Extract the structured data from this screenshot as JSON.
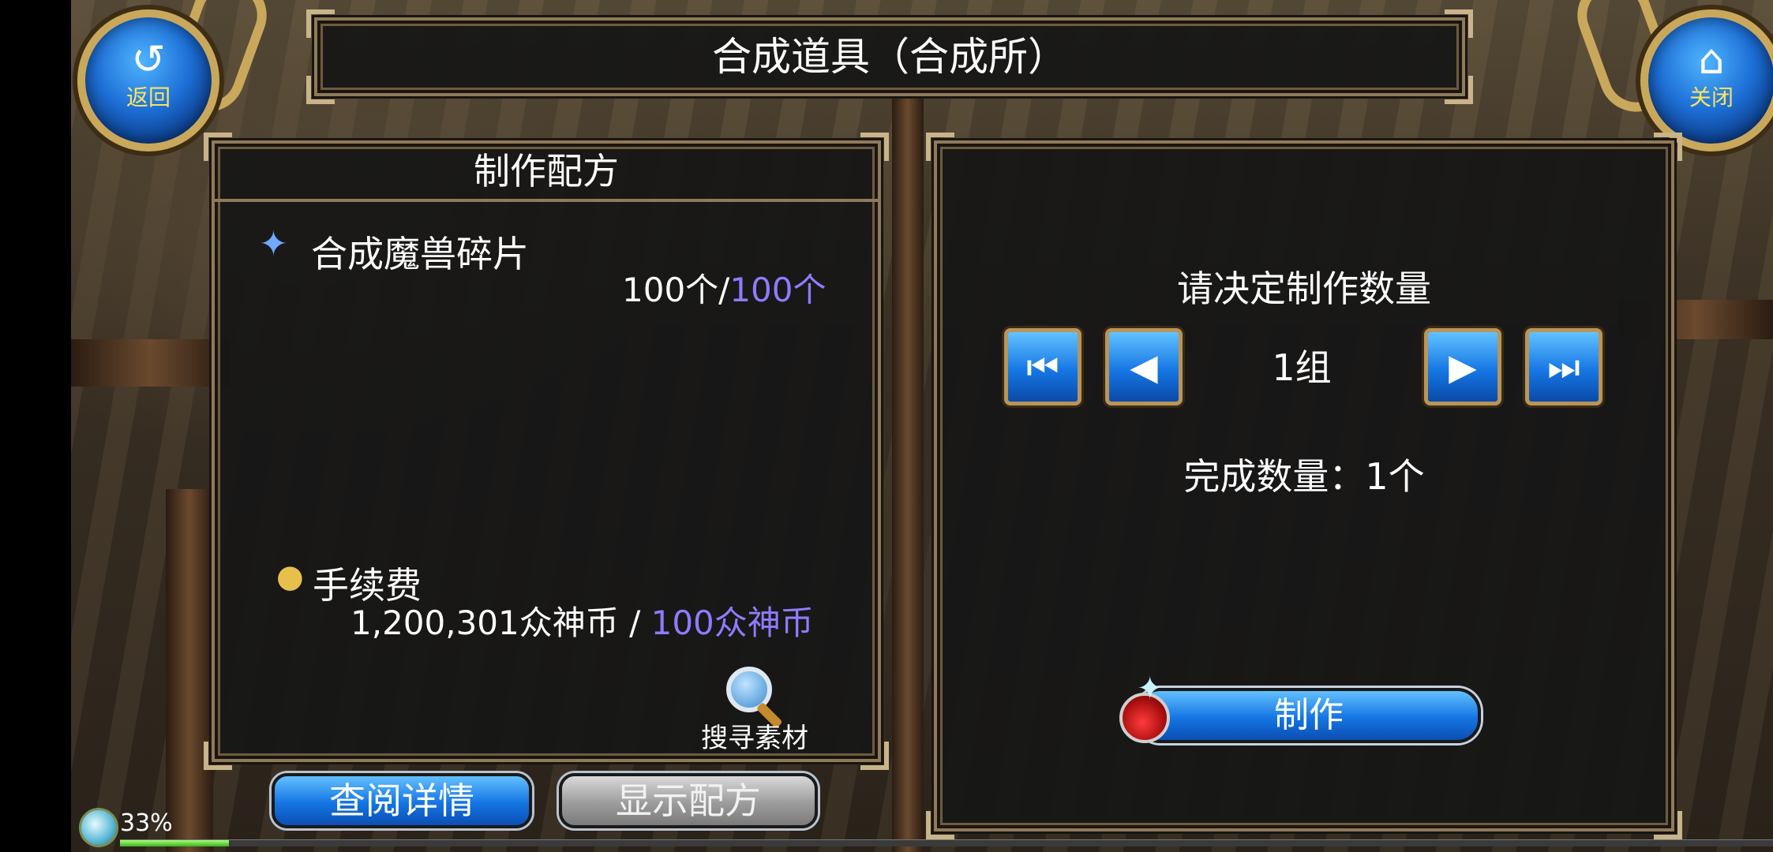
{
  "header": {
    "title": "合成道具（合成所）",
    "back_label": "返回",
    "close_label": "关闭"
  },
  "recipe": {
    "header": "制作配方",
    "material_name": "合成魔兽碎片",
    "material_have": "100个/",
    "material_need": "100个",
    "fee_label": "手续费",
    "fee_have": "1,200,301众神币 / ",
    "fee_need": "100众神币",
    "search_label": "搜寻素材"
  },
  "buttons": {
    "view_details": "查阅详情",
    "show_recipe": "显示配方"
  },
  "quantity": {
    "prompt": "请决定制作数量",
    "value": "1组",
    "completed": "完成数量：1个",
    "make_label": "制作"
  },
  "status": {
    "exp_percent_label": "33%",
    "exp_fraction": 0.33
  },
  "colors": {
    "accent_blue": "#1475e3",
    "required_text": "#8f7bff",
    "frame_gold": "#c9a85c"
  },
  "icons": [
    "back-arrow-icon",
    "home-icon",
    "sparkle-icon",
    "coin-icon",
    "search-icon",
    "first-icon",
    "prev-icon",
    "next-icon",
    "last-icon",
    "potion-icon"
  ]
}
